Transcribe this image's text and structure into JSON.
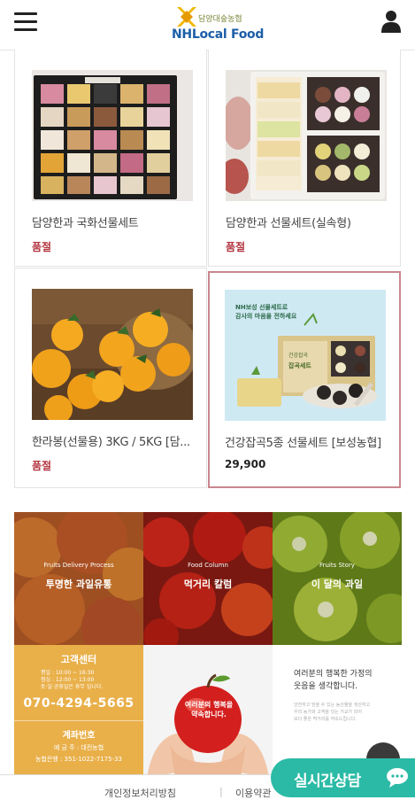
{
  "header": {
    "logo_ko": "담양대숲농협",
    "logo_en": "NHLocal Food"
  },
  "products": [
    {
      "name": "담양한과 국화선물세트",
      "status": "품절"
    },
    {
      "name": "담양한과 선물세트(실속형)",
      "status": "품절"
    },
    {
      "name": "한라봉(선물용) 3KG / 5KG [담...",
      "status": "품절"
    },
    {
      "name": "건강잡곡5종 선물세트 [보성농협]",
      "price": "29,900",
      "box_text": "NH보성 선물세트로\n감사의 마음을 전하세요",
      "box_label": "건강잡곡\n잡곡세트"
    }
  ],
  "banner": [
    {
      "tag": "Fruits Delivery Process",
      "title": "투명한 과일유통"
    },
    {
      "tag": "Food Column",
      "title": "먹거리 칼럼"
    },
    {
      "tag": "Fruits Story",
      "title": "이 달의 과일"
    }
  ],
  "customer_center": {
    "title": "고객센터",
    "hours_1": "평일 : 10:00 ~ 16:30",
    "hours_2": "점심 : 12:00 ~ 13:00",
    "hours_3": "토·일·공휴일은 휴무 입니다.",
    "phone": "070-4294-5665"
  },
  "bank": {
    "title": "계좌번호",
    "owner": "예 금 주 : 대전농협",
    "account": "농협은행 : 351-1022-7175-33"
  },
  "apple_text": "여러분의 행복을 약속합니다.",
  "message": {
    "main_1": "여러분의 행복한 가정의",
    "main_2": "웃음을 생각합니다.",
    "sub_1": "안전하고 믿을 수 있는 농산물을 생산하고",
    "sub_2": "우리 농가와 고객을 잇는 가교가 되어",
    "sub_3": "보다 좋은 먹거리를 약속드립니다."
  },
  "footer": {
    "privacy": "개인정보처리방침",
    "terms": "이용약관"
  },
  "chat": {
    "label": "실시간상담"
  },
  "colors": {
    "accent_red": "#b2343f",
    "chat_teal": "#2bbaa6",
    "cs_orange": "#e9b04a",
    "logo_blue": "#1b5ea8"
  }
}
